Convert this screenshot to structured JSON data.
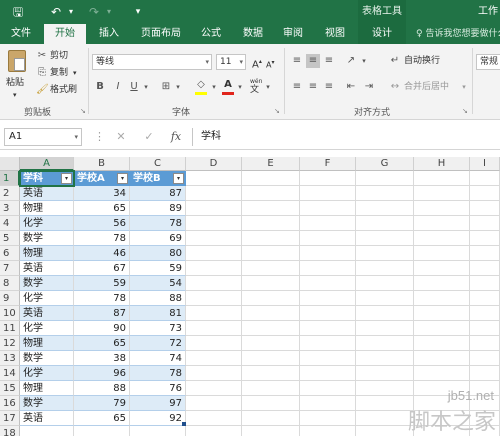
{
  "titlebar": {
    "save_icon": "save-icon",
    "undo_icon": "undo-icon",
    "redo_icon": "redo-icon",
    "contextual_tools": "表格工具",
    "app_title": "工作"
  },
  "tabs": [
    {
      "label": "文件",
      "active": false
    },
    {
      "label": "开始",
      "active": true
    },
    {
      "label": "插入",
      "active": false
    },
    {
      "label": "页面布局",
      "active": false
    },
    {
      "label": "公式",
      "active": false
    },
    {
      "label": "数据",
      "active": false
    },
    {
      "label": "审阅",
      "active": false
    },
    {
      "label": "视图",
      "active": false
    },
    {
      "label": "设计",
      "active": false
    }
  ],
  "tell_me": "♀ 告诉我您想要做什么",
  "ribbon": {
    "clipboard": {
      "paste": "粘贴",
      "cut": "剪切",
      "copy": "复制",
      "format_painter": "格式刷",
      "label": "剪贴板"
    },
    "font": {
      "family": "等线",
      "size": "11",
      "grow": "A",
      "shrink": "A",
      "bold": "B",
      "italic": "I",
      "underline": "U",
      "wen": "wén",
      "label": "字体",
      "fill_color": "#ffff00",
      "font_color": "#e0241b"
    },
    "alignment": {
      "wrap": "自动换行",
      "merge": "合并后居中",
      "label": "对齐方式"
    },
    "number": {
      "format": "常规"
    }
  },
  "formula_bar": {
    "name_box": "A1",
    "cancel": "✕",
    "enter": "✓",
    "fx": "fx",
    "value": "学科"
  },
  "sheet": {
    "columns": [
      "A",
      "B",
      "C",
      "D",
      "E",
      "F",
      "G",
      "H",
      "I"
    ],
    "header": [
      "学科",
      "学校A",
      "学校B"
    ],
    "rows": [
      [
        "英语",
        34,
        87
      ],
      [
        "物理",
        65,
        89
      ],
      [
        "化学",
        56,
        78
      ],
      [
        "数学",
        78,
        69
      ],
      [
        "物理",
        46,
        80
      ],
      [
        "英语",
        67,
        59
      ],
      [
        "数学",
        59,
        54
      ],
      [
        "化学",
        78,
        88
      ],
      [
        "英语",
        87,
        81
      ],
      [
        "化学",
        90,
        73
      ],
      [
        "物理",
        65,
        72
      ],
      [
        "数学",
        38,
        74
      ],
      [
        "化学",
        96,
        78
      ],
      [
        "物理",
        88,
        76
      ],
      [
        "数学",
        79,
        97
      ],
      [
        "英语",
        65,
        92
      ]
    ]
  },
  "watermark": {
    "url": "jb51.net",
    "name": "脚本之家"
  }
}
